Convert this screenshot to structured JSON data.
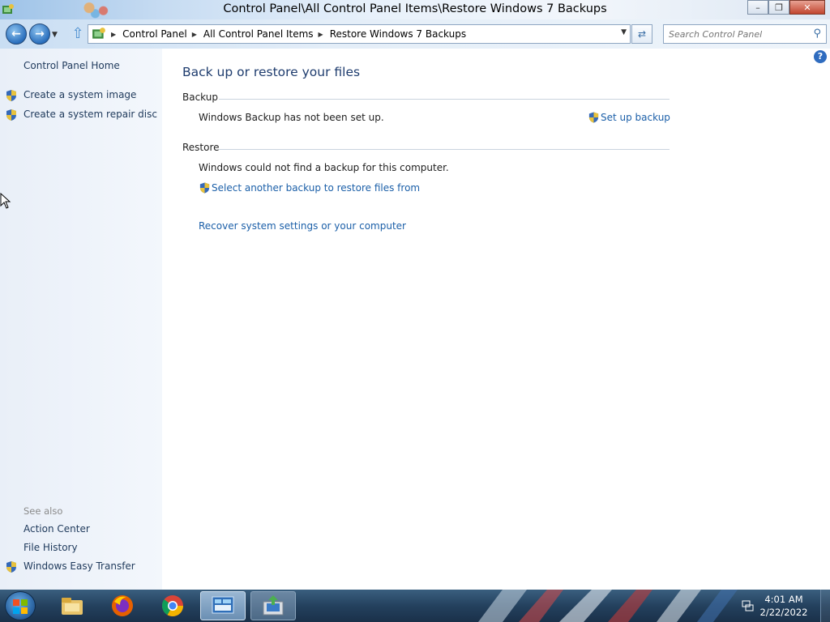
{
  "window": {
    "title": "Control Panel\\All Control Panel Items\\Restore Windows 7 Backups",
    "minimize_icon": "minimize-icon",
    "maximize_icon": "restore-icon",
    "close_icon": "close-icon"
  },
  "navigation": {
    "breadcrumbs": [
      "Control Panel",
      "All Control Panel Items",
      "Restore Windows 7 Backups"
    ],
    "search_placeholder": "Search Control Panel"
  },
  "left_pane": {
    "home_link": "Control Panel Home",
    "tasks": [
      "Create a system image",
      "Create a system repair disc"
    ],
    "see_also_label": "See also",
    "see_also": [
      "Action Center",
      "File History",
      "Windows Easy Transfer"
    ]
  },
  "main": {
    "heading": "Back up or restore your files",
    "backup": {
      "label": "Backup",
      "status": "Windows Backup has not been set up.",
      "action": "Set up backup"
    },
    "restore": {
      "label": "Restore",
      "status": "Windows could not find a backup for this computer.",
      "select_link": "Select another backup to restore files from",
      "recover_link": "Recover system settings or your computer"
    }
  },
  "taskbar": {
    "pinned": [
      "file-explorer-icon",
      "firefox-icon",
      "chrome-icon",
      "control-panel-icon",
      "backup-restore-icon"
    ],
    "clock": {
      "time": "4:01 AM",
      "date": "2/22/2022"
    }
  },
  "colors": {
    "link": "#1b5fa8",
    "heading": "#1e3c6e",
    "left_pane": "#e9eff8",
    "taskbar": "#24415e"
  }
}
